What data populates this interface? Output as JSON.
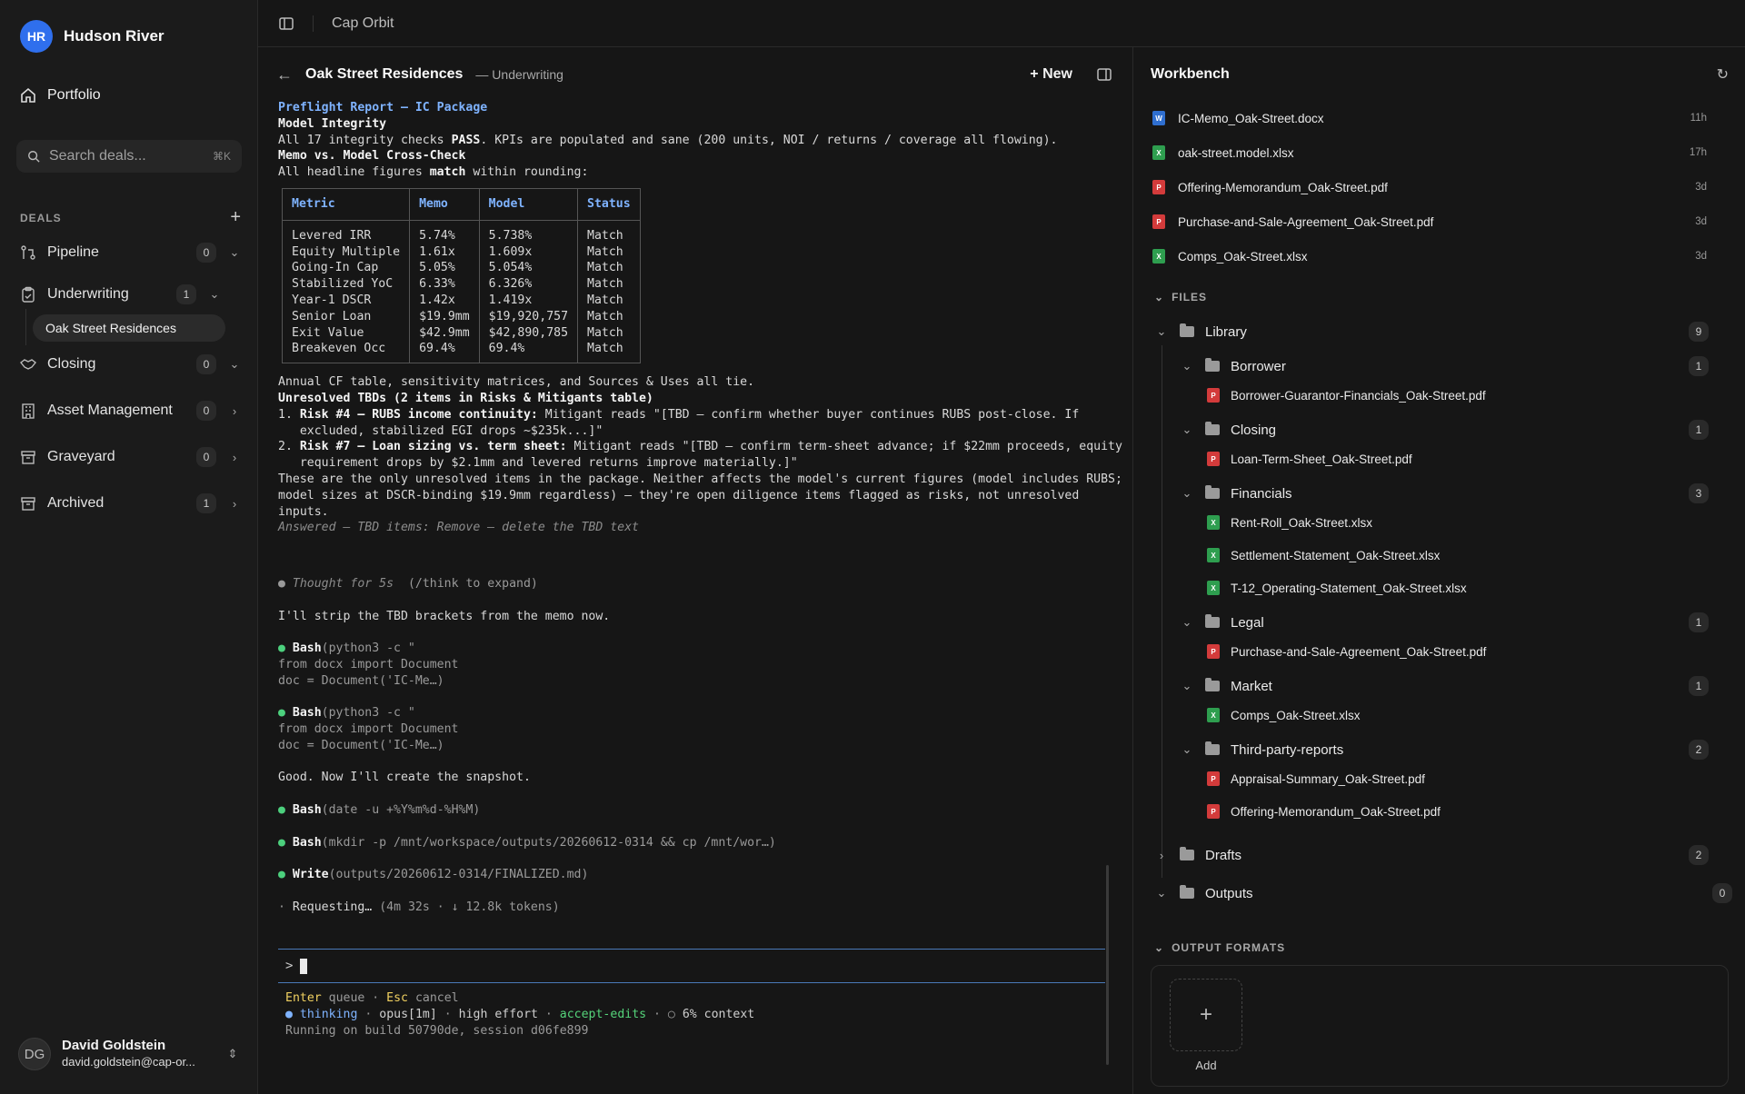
{
  "org": {
    "initials": "HR",
    "name": "Hudson River"
  },
  "nav": {
    "portfolio": "Portfolio"
  },
  "search": {
    "placeholder": "Search deals...",
    "shortcut": "⌘K"
  },
  "deals": {
    "heading": "DEALS",
    "stages": [
      {
        "label": "Pipeline",
        "count": "0"
      },
      {
        "label": "Underwriting",
        "count": "1"
      },
      {
        "label": "Closing",
        "count": "0"
      },
      {
        "label": "Asset Management",
        "count": "0"
      },
      {
        "label": "Graveyard",
        "count": "0"
      },
      {
        "label": "Archived",
        "count": "1"
      }
    ],
    "active_deal": "Oak Street Residences"
  },
  "user": {
    "initials": "DG",
    "name": "David Goldstein",
    "email": "david.goldstein@cap-or..."
  },
  "topbar": {
    "title": "Cap Orbit"
  },
  "chat": {
    "title": "Oak Street Residences",
    "subtitle": "— Underwriting",
    "new_label": "New",
    "report_title": "Preflight Report — IC Package",
    "model_integrity_heading": "Model Integrity",
    "model_integrity_pre": "All 17 integrity checks ",
    "model_integrity_bold": "PASS",
    "model_integrity_post": ". KPIs are populated and sane (200 units, NOI / returns / coverage all flowing).",
    "memo_heading": "Memo vs. Model Cross-Check",
    "memo_pre": "All headline figures ",
    "memo_bold": "match",
    "memo_post": " within rounding:",
    "table": {
      "headers": [
        "Metric",
        "Memo",
        "Model",
        "Status"
      ],
      "rows": [
        [
          "Levered IRR",
          "5.74%",
          "5.738%",
          "Match"
        ],
        [
          "Equity Multiple",
          "1.61x",
          "1.609x",
          "Match"
        ],
        [
          "Going-In Cap",
          "5.05%",
          "5.054%",
          "Match"
        ],
        [
          "Stabilized YoC",
          "6.33%",
          "6.326%",
          "Match"
        ],
        [
          "Year-1 DSCR",
          "1.42x",
          "1.419x",
          "Match"
        ],
        [
          "Senior Loan",
          "$19.9mm",
          "$19,920,757",
          "Match"
        ],
        [
          "Exit Value",
          "$42.9mm",
          "$42,890,785",
          "Match"
        ],
        [
          "Breakeven Occ",
          "69.4%",
          "69.4%",
          "Match"
        ]
      ]
    },
    "after_table": "Annual CF table, sensitivity matrices, and Sources & Uses all tie.",
    "tbd_heading": "Unresolved TBDs (2 items in Risks & Mitigants table)",
    "tbd1_num": "1. ",
    "tbd1_bold": "Risk #4 — RUBS income continuity:",
    "tbd1_text": " Mitigant reads \"[TBD — confirm whether buyer continues RUBS post-close. If\n   excluded, stabilized EGI drops ~$235k...]\"",
    "tbd2_num": "2. ",
    "tbd2_bold": "Risk #7 — Loan sizing vs. term sheet:",
    "tbd2_text": " Mitigant reads \"[TBD — confirm term-sheet advance; if $22mm proceeds, equity\n   requirement drops by $2.1mm and levered returns improve materially.]\"",
    "tbd_summary": "These are the only unresolved items in the package. Neither affects the model's current figures (model includes RUBS;\nmodel sizes at DSCR-binding $19.9mm regardless) — they're open diligence items flagged as risks, not unresolved\ninputs.",
    "answered": "Answered — TBD items: Remove — delete the TBD text",
    "thought": "Thought for 5s",
    "thought_hint": "(/think to expand)",
    "strip_msg": "I'll strip the TBD brackets from the memo now.",
    "bash1_name": "Bash",
    "bash1_cmd": "(python3 -c \"\nfrom docx import Document\ndoc = Document('IC-Me…)",
    "bash2_name": "Bash",
    "bash2_cmd": "(python3 -c \"\nfrom docx import Document\ndoc = Document('IC-Me…)",
    "good_msg": "Good. Now I'll create the snapshot.",
    "bash3_name": "Bash",
    "bash3_cmd": "(date -u +%Y%m%d-%H%M)",
    "bash4_name": "Bash",
    "bash4_cmd": "(mkdir -p /mnt/workspace/outputs/20260612-0314 && cp /mnt/wor…)",
    "write_name": "Write",
    "write_cmd": "(outputs/20260612-0314/FINALIZED.md)",
    "requesting": "Requesting…",
    "requesting_meta": "(4m 32s · ↓ 12.8k tokens)",
    "prompt_symbol": ">",
    "footer": {
      "enter_key": "Enter",
      "enter_text": " queue · ",
      "esc_key": "Esc",
      "esc_text": " cancel",
      "thinking": "thinking",
      "model": "opus[1m]",
      "effort": "high effort",
      "mode": "accept-edits",
      "context": "6% context",
      "build": "Running on build 50790de, session d06fe899"
    }
  },
  "workbench": {
    "title": "Workbench",
    "recent": [
      {
        "name": "IC-Memo_Oak-Street.docx",
        "type": "docx",
        "age": "11h"
      },
      {
        "name": "oak-street.model.xlsx",
        "type": "xlsx",
        "age": "17h"
      },
      {
        "name": "Offering-Memorandum_Oak-Street.pdf",
        "type": "pdf",
        "age": "3d"
      },
      {
        "name": "Purchase-and-Sale-Agreement_Oak-Street.pdf",
        "type": "pdf",
        "age": "3d"
      },
      {
        "name": "Comps_Oak-Street.xlsx",
        "type": "xlsx",
        "age": "3d"
      }
    ],
    "files_heading": "FILES",
    "library": {
      "name": "Library",
      "count": "9"
    },
    "folders": [
      {
        "name": "Borrower",
        "count": "1",
        "files": [
          "Borrower-Guarantor-Financials_Oak-Street.pdf"
        ]
      },
      {
        "name": "Closing",
        "count": "1",
        "files": [
          "Loan-Term-Sheet_Oak-Street.pdf"
        ]
      },
      {
        "name": "Financials",
        "count": "3",
        "files": [
          "Rent-Roll_Oak-Street.xlsx",
          "Settlement-Statement_Oak-Street.xlsx",
          "T-12_Operating-Statement_Oak-Street.xlsx"
        ]
      },
      {
        "name": "Legal",
        "count": "1",
        "files": [
          "Purchase-and-Sale-Agreement_Oak-Street.pdf"
        ]
      },
      {
        "name": "Market",
        "count": "1",
        "files": [
          "Comps_Oak-Street.xlsx"
        ]
      },
      {
        "name": "Third-party-reports",
        "count": "2",
        "files": [
          "Appraisal-Summary_Oak-Street.pdf",
          "Offering-Memorandum_Oak-Street.pdf"
        ]
      }
    ],
    "drafts": {
      "name": "Drafts",
      "count": "2"
    },
    "outputs": {
      "name": "Outputs",
      "count": "0"
    },
    "output_formats_heading": "OUTPUT FORMATS",
    "add_label": "Add"
  }
}
